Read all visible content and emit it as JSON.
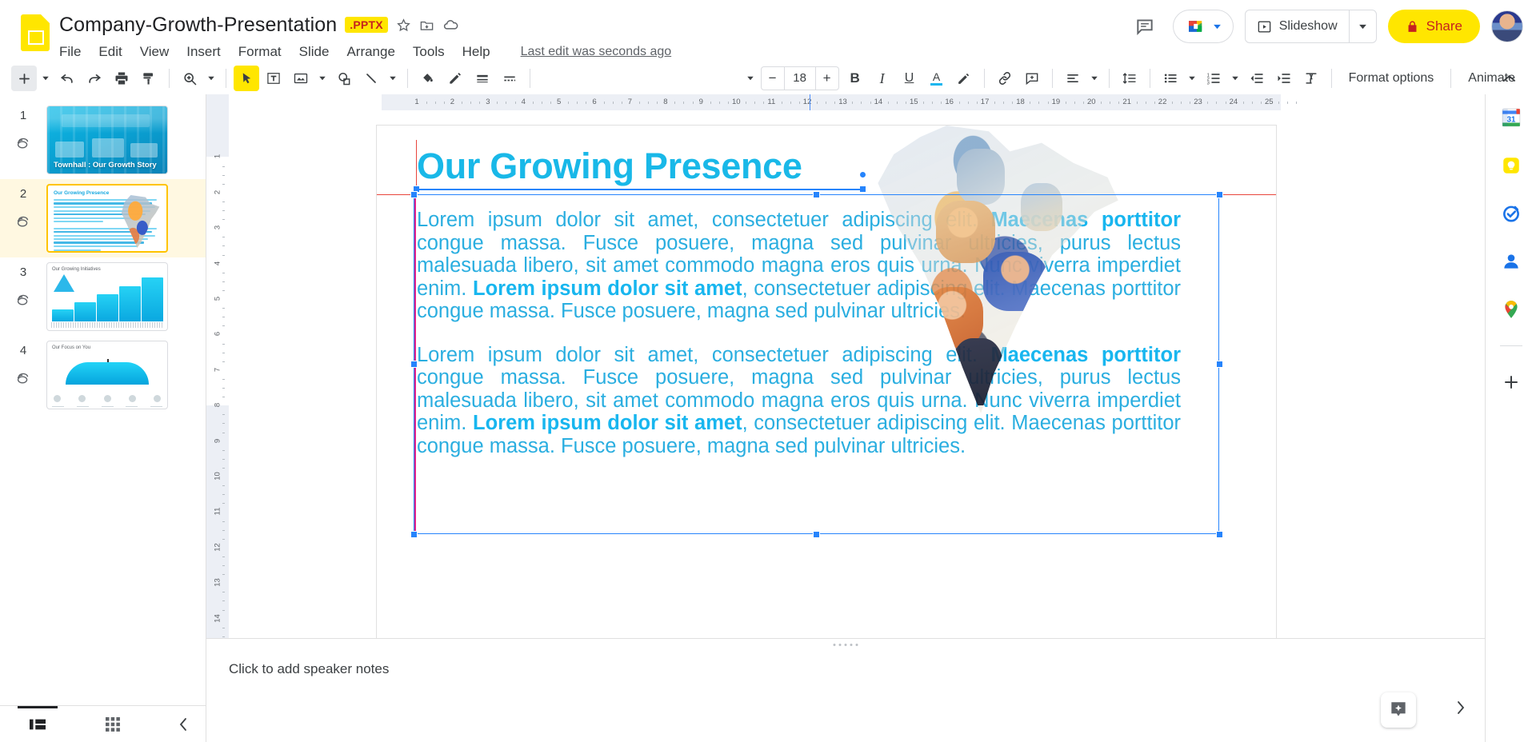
{
  "app": {
    "name": "Google Slides",
    "doc_icon": "slides-file-icon"
  },
  "header": {
    "title": "Company-Growth-Presentation",
    "format_badge": ".PPTX",
    "star_icon": "star-icon",
    "move_icon": "move-to-folder-icon",
    "cloud_icon": "cloud-saved-icon",
    "last_edit": "Last edit was seconds ago",
    "menus": [
      "File",
      "Edit",
      "View",
      "Insert",
      "Format",
      "Slide",
      "Arrange",
      "Tools",
      "Help"
    ],
    "comment_icon": "comment-history-icon",
    "meet_icon": "google-meet-icon",
    "slideshow_label": "Slideshow",
    "share_label": "Share",
    "share_lock_icon": "lock-icon",
    "share_bg": "#FFE600",
    "share_fg": "#C5221F",
    "avatar": "user-avatar"
  },
  "toolbar": {
    "font_size": "18",
    "format_options_label": "Format options",
    "animate_label": "Animate",
    "items": [
      "new-slide-icon",
      "undo-icon",
      "redo-icon",
      "print-icon",
      "paint-format-icon",
      "zoom-icon",
      "select-tool-icon",
      "text-box-icon",
      "insert-image-icon",
      "shape-icon",
      "line-icon",
      "fill-color-icon",
      "border-color-icon",
      "border-weight-icon",
      "border-dash-icon",
      "bold-icon",
      "italic-icon",
      "underline-icon",
      "text-color-icon",
      "highlight-color-icon",
      "insert-link-icon",
      "add-comment-icon",
      "align-icon",
      "line-spacing-icon",
      "bulleted-list-icon",
      "numbered-list-icon",
      "decrease-indent-icon",
      "increase-indent-icon",
      "clear-formatting-icon",
      "collapse-toolbar-icon"
    ],
    "selected_tool": "select-tool-icon",
    "text_color_accent": "#18b6ef"
  },
  "filmstrip": {
    "slides": [
      {
        "number": "1",
        "title": "Townhall : Our Growth Story",
        "thumb": "townhall-photo-thumb",
        "active": false
      },
      {
        "number": "2",
        "title": "Our Growing Presence",
        "thumb": "growing-presence-thumb",
        "active": true
      },
      {
        "number": "3",
        "title": "Our Growing Initiatives",
        "thumb": "initiatives-chart-thumb",
        "active": false
      },
      {
        "number": "4",
        "title": "Our Focus on You",
        "thumb": "focus-umbrella-thumb",
        "active": false
      }
    ],
    "view_filmstrip_icon": "filmstrip-view-icon",
    "view_grid_icon": "grid-view-icon",
    "collapse_icon": "collapse-panel-icon"
  },
  "ruler": {
    "horizontal_ticks": [
      "1",
      "2",
      "3",
      "4",
      "5",
      "6",
      "7",
      "8",
      "9",
      "10",
      "11",
      "12",
      "13",
      "14",
      "15",
      "16",
      "17",
      "18",
      "19",
      "20",
      "21",
      "22",
      "23",
      "24",
      "25"
    ],
    "vertical_ticks": [
      "1",
      "2",
      "3",
      "4",
      "5",
      "6",
      "7",
      "8",
      "9",
      "10",
      "11",
      "12",
      "13",
      "14"
    ]
  },
  "slide": {
    "title": "Our Growing Presence",
    "title_color": "#19b8e8",
    "body_color": "#2aaee0",
    "image_name": "india-map-collage-image",
    "paragraphs": [
      {
        "runs": [
          {
            "text": "Lorem ipsum dolor sit amet, consectetuer adipiscing elit. ",
            "bold": false
          },
          {
            "text": "Maecenas porttitor",
            "bold": true
          },
          {
            "text": " congue massa. Fusce posuere, magna sed pulvinar ultricies, purus lectus malesuada libero, sit amet commodo magna eros quis urna. Nunc viverra imperdiet enim. ",
            "bold": false
          },
          {
            "text": "Lorem ipsum dolor sit amet",
            "bold": true
          },
          {
            "text": ", consectetuer adipiscing elit. Maecenas porttitor congue massa. Fusce posuere, magna sed pulvinar ultricies.",
            "bold": false
          }
        ]
      },
      {
        "runs": [
          {
            "text": "Lorem ipsum dolor sit amet, consectetuer adipiscing elit. ",
            "bold": false
          },
          {
            "text": "Maecenas porttitor",
            "bold": true
          },
          {
            "text": " congue massa. Fusce posuere, magna sed pulvinar ultricies, purus lectus malesuada libero, sit amet commodo magna eros quis urna. Nunc viverra imperdiet enim. ",
            "bold": false
          },
          {
            "text": "Lorem ipsum dolor sit amet",
            "bold": true
          },
          {
            "text": ", consectetuer adipiscing elit. Maecenas porttitor congue massa. Fusce posuere, magna sed pulvinar ultricies.",
            "bold": false
          }
        ]
      }
    ]
  },
  "notes": {
    "placeholder": "Click to add speaker notes"
  },
  "footer": {
    "explore_icon": "explore-sparkle-icon",
    "expand_icon": "expand-panel-icon"
  },
  "app_rail": {
    "icons": [
      "google-calendar-icon",
      "google-keep-icon",
      "google-tasks-icon",
      "google-contacts-icon",
      "google-maps-icon",
      "add-app-icon"
    ]
  }
}
